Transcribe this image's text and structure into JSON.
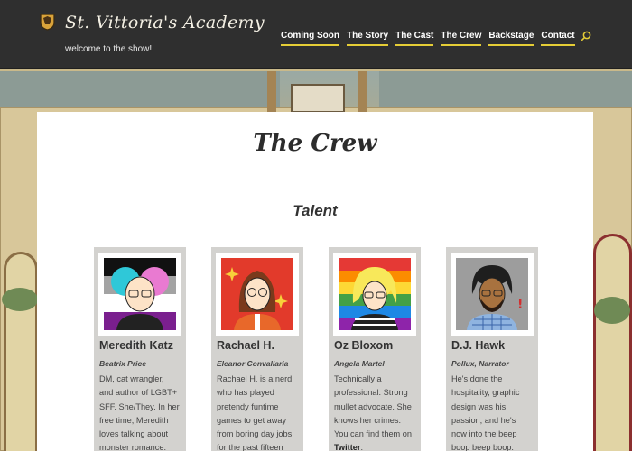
{
  "header": {
    "site_title": "St. Vittoria's Academy",
    "tagline": "welcome to the show!",
    "nav": [
      "Coming Soon",
      "The Story",
      "The Cast",
      "The Crew",
      "Backstage",
      "Contact"
    ],
    "nav_underline_color": "#e5cd36"
  },
  "main": {
    "page_title": "The Crew",
    "section_title": "Talent",
    "crew": [
      {
        "name": "Meredith Katz",
        "role": "Beatrix Price",
        "bio_lines": [
          "DM, cat wrangler,",
          "and author of LGBT+",
          "SFF. She/They. In her",
          "free time, Meredith",
          "loves talking about",
          "monster romance."
        ],
        "portrait_bg": "asexual-flag",
        "link_text": ""
      },
      {
        "name": "Rachael H.",
        "role": "Eleanor Convallaria",
        "bio_lines": [
          "Rachael H. is a nerd",
          "who has played",
          "pretendy funtime",
          "games to get away",
          "from boring day jobs",
          "for the past fifteen"
        ],
        "portrait_bg": "red-sparkle",
        "link_text": ""
      },
      {
        "name": "Oz Bloxom",
        "role": "Angela Martel",
        "bio_lines": [
          "Technically a",
          "professional. Strong",
          "mullet advocate. She",
          "knows her crimes.",
          "You can find them on"
        ],
        "bio_suffix": ".",
        "link_text": "Twitter",
        "portrait_bg": "rainbow-flag"
      },
      {
        "name": "D.J. Hawk",
        "role": "Pollux, Narrator",
        "bio_lines": [
          "He's done the",
          "hospitality, graphic",
          "design was his",
          "passion, and he's",
          "now into the beep",
          "boop beep boop."
        ],
        "portrait_bg": "gray",
        "link_text": ""
      }
    ]
  }
}
